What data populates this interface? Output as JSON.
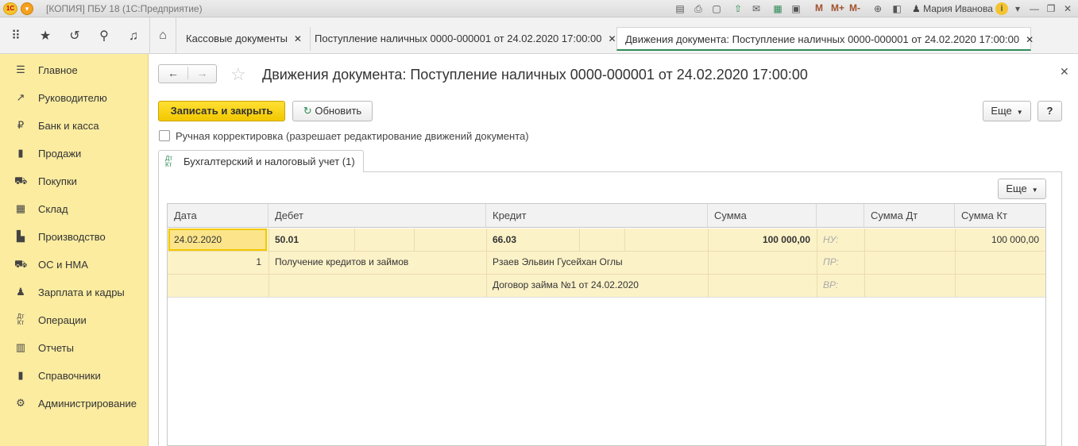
{
  "titlebar": {
    "title": "[КОПИЯ] ПБУ 18  (1С:Предприятие)",
    "logo": "1С",
    "m_labels": [
      "M",
      "M+",
      "M-"
    ],
    "user": "Мария Иванова"
  },
  "tabs": [
    {
      "label": "Кассовые документы"
    },
    {
      "label": "Поступление наличных 0000-000001 от 24.02.2020 17:00:00"
    },
    {
      "label": "Движения документа: Поступление наличных 0000-000001 от 24.02.2020 17:00:00"
    }
  ],
  "tab_close": "✕",
  "sidebar": {
    "items": [
      {
        "label": "Главное",
        "icon": "menu-icon"
      },
      {
        "label": "Руководителю",
        "icon": "trend-icon"
      },
      {
        "label": "Банк и касса",
        "icon": "ruble-icon"
      },
      {
        "label": "Продажи",
        "icon": "cart-icon"
      },
      {
        "label": "Покупки",
        "icon": "basket-icon"
      },
      {
        "label": "Склад",
        "icon": "warehouse-icon"
      },
      {
        "label": "Производство",
        "icon": "factory-icon"
      },
      {
        "label": "ОС и НМА",
        "icon": "truck-icon"
      },
      {
        "label": "Зарплата и кадры",
        "icon": "person-icon"
      },
      {
        "label": "Операции",
        "icon": "dtkt-icon"
      },
      {
        "label": "Отчеты",
        "icon": "chart-icon"
      },
      {
        "label": "Справочники",
        "icon": "book-icon"
      },
      {
        "label": "Администрирование",
        "icon": "gear-icon"
      }
    ]
  },
  "form": {
    "title": "Движения документа: Поступление наличных 0000-000001 от 24.02.2020 17:00:00",
    "save_close": "Записать и закрыть",
    "refresh": "Обновить",
    "more": "Еще",
    "help": "?",
    "manual_label": "Ручная корректировка (разрешает редактирование движений документа)",
    "manual_checked": false,
    "subtab_label": "Бухгалтерский и налоговый учет (1)",
    "subtab_icon_top": "Дт",
    "subtab_icon_bottom": "Кт",
    "table_more": "Еще"
  },
  "table": {
    "headers": [
      "Дата",
      "Дебет",
      "Кредит",
      "Сумма",
      "",
      "Сумма Дт",
      "Сумма Кт"
    ],
    "row": {
      "date": "24.02.2020",
      "number": "1",
      "debit_account": "50.01",
      "debit_sub1": "Получение кредитов и займов",
      "credit_account": "66.03",
      "credit_sub1": "Рзаев Эльвин Гусейхан Оглы",
      "credit_sub2": "Договор займа №1 от 24.02.2020",
      "amount": "100 000,00",
      "nu": "НУ:",
      "pr": "ПР:",
      "vr": "ВР:",
      "amount_kt": "100 000,00"
    }
  }
}
